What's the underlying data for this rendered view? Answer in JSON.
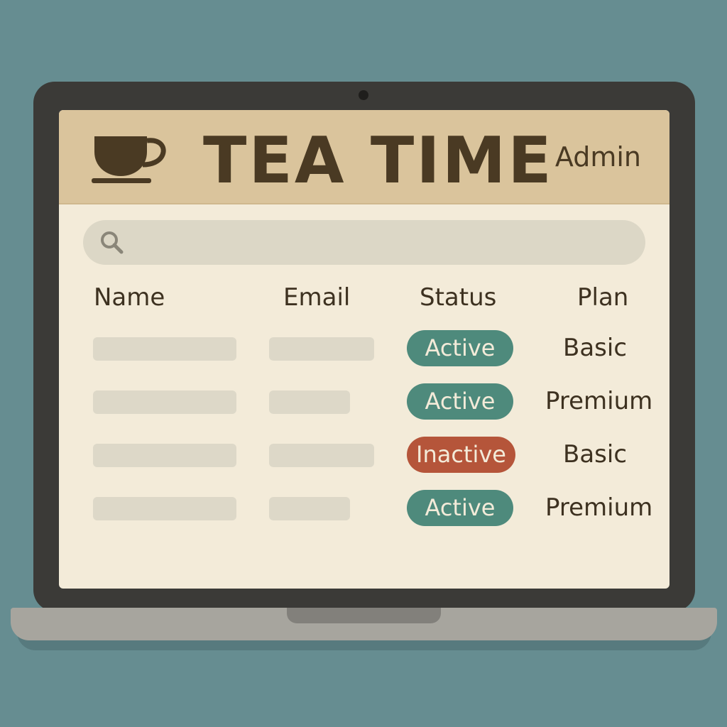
{
  "header": {
    "app_title": "TEA TIME",
    "user_label": "Admin",
    "icon": "teacup-icon"
  },
  "search": {
    "placeholder": "",
    "icon": "search-icon"
  },
  "table": {
    "columns": [
      "Name",
      "Email",
      "Status",
      "Plan"
    ],
    "rows": [
      {
        "status": "Active",
        "status_kind": "active",
        "plan": "Basic"
      },
      {
        "status": "Active",
        "status_kind": "active",
        "plan": "Premium"
      },
      {
        "status": "Inactive",
        "status_kind": "inactive",
        "plan": "Basic"
      },
      {
        "status": "Active",
        "status_kind": "active",
        "plan": "Premium"
      }
    ]
  },
  "colors": {
    "active": "#4e8a7c",
    "inactive": "#b5553a",
    "header_bg": "#dac49c",
    "screen_bg": "#f3ebd9",
    "text": "#3d3120"
  }
}
